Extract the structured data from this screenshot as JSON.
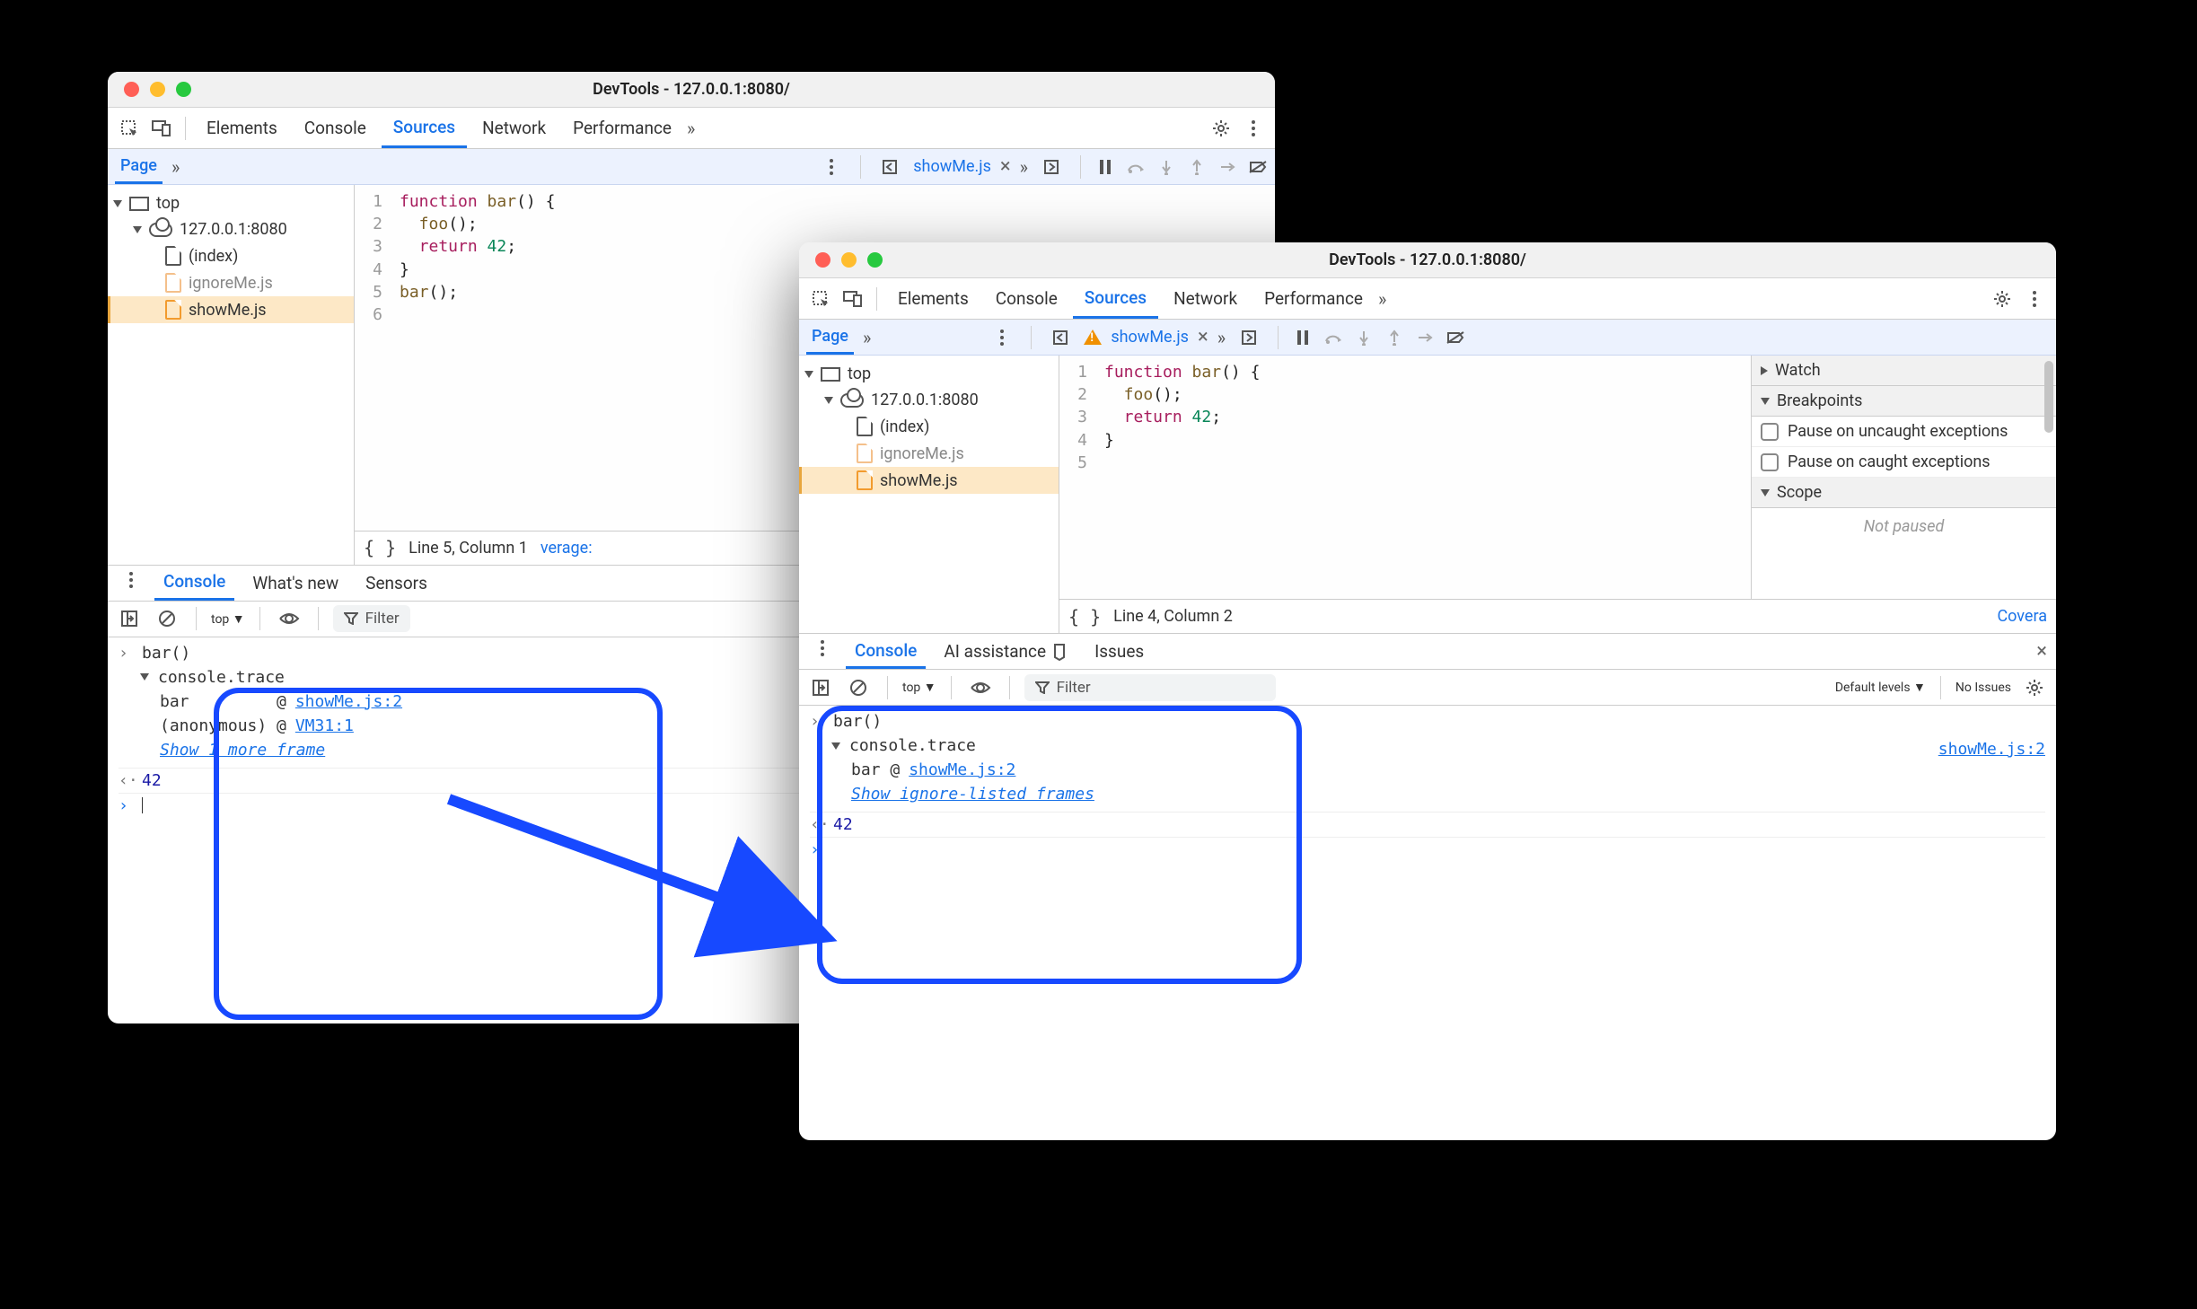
{
  "left": {
    "title": "DevTools - 127.0.0.1:8080/",
    "tabs": [
      "Elements",
      "Console",
      "Sources",
      "Network",
      "Performance"
    ],
    "active_tab": "Sources",
    "page_label": "Page",
    "open_file": "showMe.js",
    "tree": {
      "top": "top",
      "host": "127.0.0.1:8080",
      "files": [
        "(index)",
        "ignoreMe.js",
        "showMe.js"
      ]
    },
    "code": {
      "lines": [
        "1",
        "2",
        "3",
        "4",
        "5",
        "6"
      ],
      "src": [
        {
          "t": "function ",
          "c": "kw"
        },
        {
          "t": "bar",
          "c": "fn"
        },
        {
          "t": "() {",
          "c": "pn"
        },
        "\n",
        {
          "t": "  foo",
          "c": "fn"
        },
        {
          "t": "();",
          "c": "pn"
        },
        "\n",
        {
          "t": "  return ",
          "c": "kw"
        },
        {
          "t": "42",
          "c": "num"
        },
        {
          "t": ";",
          "c": "pn"
        },
        "\n",
        {
          "t": "}",
          "c": "pn"
        },
        "\n",
        {
          "t": "",
          "c": "pn"
        },
        "\n",
        {
          "t": "bar",
          "c": "fn"
        },
        {
          "t": "();",
          "c": "pn"
        }
      ]
    },
    "status": "Line 5, Column 1",
    "status_extra": "verage:",
    "bottom_tabs": [
      "Console",
      "What's new",
      "Sensors"
    ],
    "bottom_active": "Console",
    "ctx_label": "top",
    "filter_label": "Filter",
    "console": {
      "call": "bar()",
      "trace": "console.trace",
      "rows": [
        {
          "fn": "bar",
          "at": "@",
          "loc": "showMe.js:2"
        },
        {
          "fn": "(anonymous)",
          "at": "@",
          "loc": "VM31:1"
        }
      ],
      "more": "Show 1 more frame",
      "ret": "42"
    }
  },
  "right": {
    "title": "DevTools - 127.0.0.1:8080/",
    "tabs": [
      "Elements",
      "Console",
      "Sources",
      "Network",
      "Performance"
    ],
    "active_tab": "Sources",
    "page_label": "Page",
    "open_file": "showMe.js",
    "tree": {
      "top": "top",
      "host": "127.0.0.1:8080",
      "files": [
        "(index)",
        "ignoreMe.js",
        "showMe.js"
      ]
    },
    "code": {
      "lines": [
        "1",
        "2",
        "3",
        "4",
        "5"
      ],
      "src": [
        {
          "t": "function ",
          "c": "kw"
        },
        {
          "t": "bar",
          "c": "fn"
        },
        {
          "t": "() {",
          "c": "pn"
        },
        "\n",
        {
          "t": "  foo",
          "c": "fn"
        },
        {
          "t": "();",
          "c": "pn"
        },
        "\n",
        {
          "t": "  return ",
          "c": "kw"
        },
        {
          "t": "42",
          "c": "num"
        },
        {
          "t": ";",
          "c": "pn"
        },
        "\n",
        {
          "t": "}",
          "c": "pn"
        },
        "\n",
        {
          "t": "",
          "c": "pn"
        }
      ]
    },
    "status": "Line 4, Column 2",
    "status_extra": "Covera",
    "side": {
      "watch": "Watch",
      "breakpoints": "Breakpoints",
      "p1": "Pause on uncaught exceptions",
      "p2": "Pause on caught exceptions",
      "scope": "Scope",
      "not_paused": "Not paused"
    },
    "bottom_tabs": [
      "Console",
      "AI assistance",
      "Issues"
    ],
    "bottom_active": "Console",
    "ctx_label": "top",
    "filter_label": "Filter",
    "levels": "Default levels",
    "no_issues": "No Issues",
    "console": {
      "call": "bar()",
      "trace": "console.trace",
      "loc_main": "showMe.js:2",
      "row": "bar @ ",
      "row_loc": "showMe.js:2",
      "more": "Show ignore-listed frames",
      "ret": "42"
    }
  }
}
